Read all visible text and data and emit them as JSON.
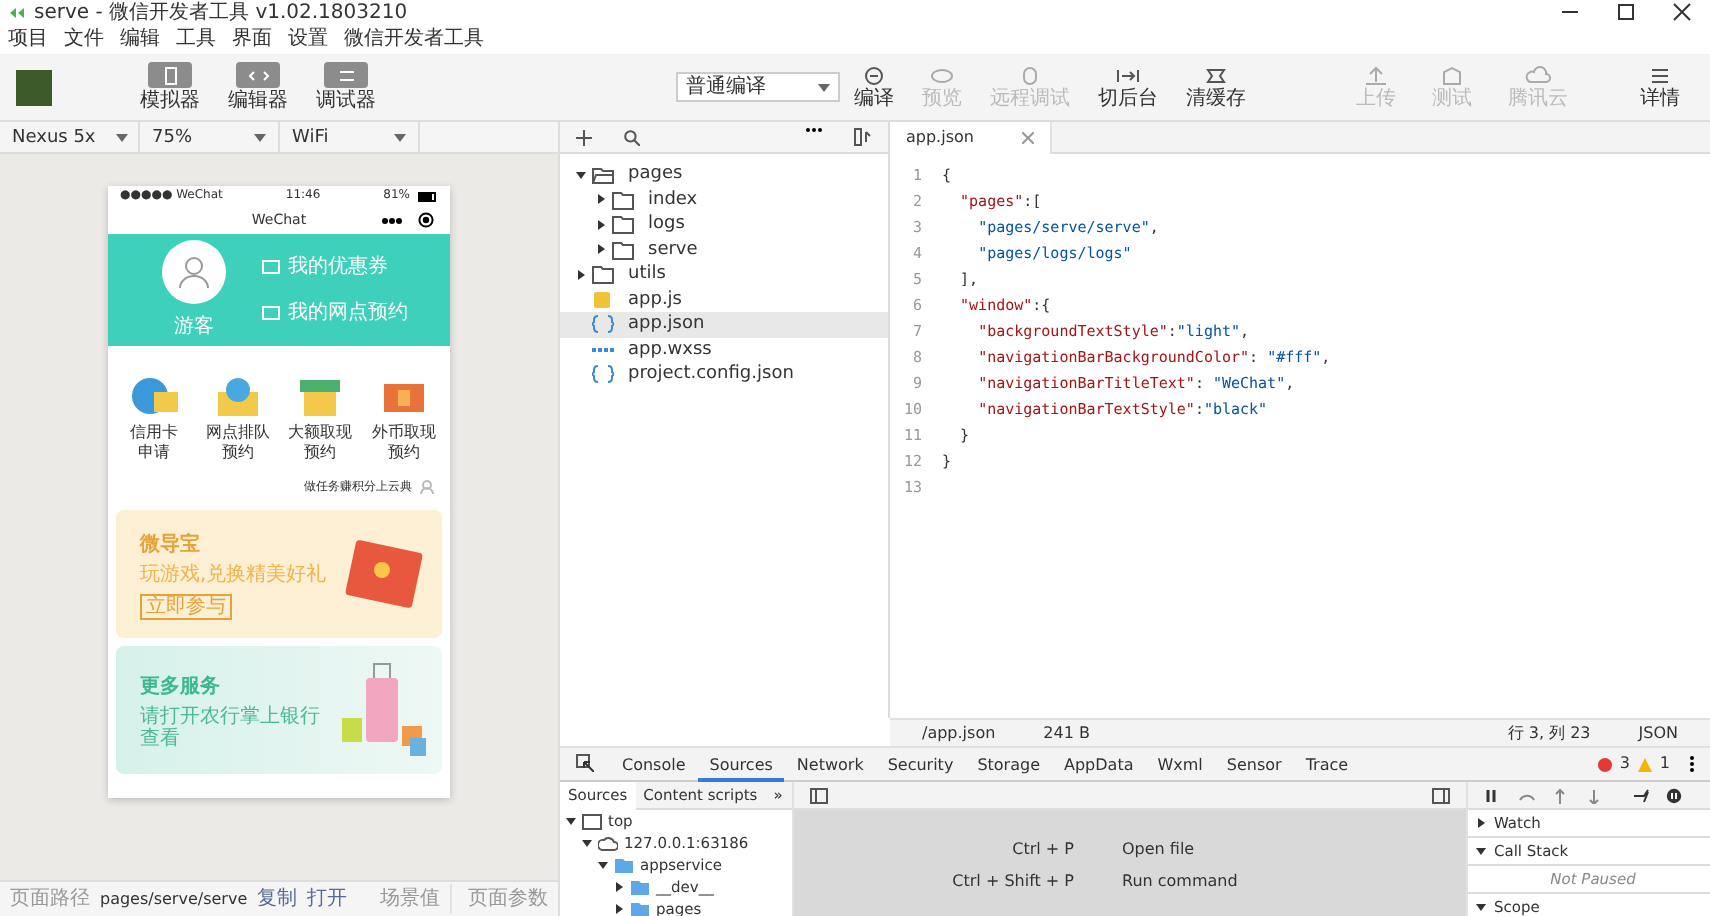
{
  "window": {
    "title": "serve - 微信开发者工具 v1.02.1803210"
  },
  "menu": [
    "项目",
    "文件",
    "编辑",
    "工具",
    "界面",
    "设置",
    "微信开发者工具"
  ],
  "toolbar": {
    "views": [
      {
        "label": "模拟器"
      },
      {
        "label": "编辑器"
      },
      {
        "label": "调试器"
      }
    ],
    "compile_mode": "普通编译",
    "actions": [
      {
        "label": "编译",
        "disabled": false
      },
      {
        "label": "预览",
        "disabled": true
      },
      {
        "label": "远程调试",
        "disabled": true
      },
      {
        "label": "切后台",
        "disabled": false
      },
      {
        "label": "清缓存",
        "disabled": false
      }
    ],
    "right_actions": [
      {
        "label": "上传",
        "disabled": true
      },
      {
        "label": "测试",
        "disabled": true
      },
      {
        "label": "腾讯云",
        "disabled": true
      },
      {
        "label": "详情",
        "disabled": false
      }
    ]
  },
  "simulator": {
    "device": "Nexus 5x",
    "zoom": "75%",
    "network": "WiFi",
    "phone": {
      "carrier": "●●●●● WeChat",
      "time": "11:46",
      "battery": "81%",
      "nav_title": "WeChat",
      "profile": {
        "name": "游客",
        "links": [
          "我的优惠券",
          "我的网点预约"
        ]
      },
      "services": [
        {
          "lines": [
            "信用卡",
            "申请"
          ]
        },
        {
          "lines": [
            "网点排队",
            "预约"
          ]
        },
        {
          "lines": [
            "大额取现",
            "预约"
          ]
        },
        {
          "lines": [
            "外币取现",
            "预约"
          ]
        }
      ],
      "note": "做任务赚积分上云典",
      "banners": [
        {
          "kind": "promo",
          "title": "微导宝",
          "subtitle": "玩游戏,兑换精美好礼",
          "button": "立即参与"
        },
        {
          "kind": "services",
          "title": "更多服务",
          "subtitle": "请打开农行掌上银行查看"
        }
      ]
    },
    "status_bar": {
      "path_label": "页面路径",
      "path": "pages/serve/serve",
      "copy": "复制",
      "open": "打开",
      "scene": "场景值",
      "params": "页面参数"
    }
  },
  "file_tree": [
    {
      "name": "pages",
      "kind": "folder",
      "expanded": true,
      "selected": false,
      "children": [
        {
          "name": "index",
          "kind": "folder",
          "expanded": false,
          "selected": false
        },
        {
          "name": "logs",
          "kind": "folder",
          "expanded": false,
          "selected": false
        },
        {
          "name": "serve",
          "kind": "folder",
          "expanded": false,
          "selected": false
        }
      ]
    },
    {
      "name": "utils",
      "kind": "folder",
      "expanded": false,
      "selected": false
    },
    {
      "name": "app.js",
      "kind": "js",
      "selected": false
    },
    {
      "name": "app.json",
      "kind": "json",
      "selected": true
    },
    {
      "name": "app.wxss",
      "kind": "wxss",
      "selected": false
    },
    {
      "name": "project.config.json",
      "kind": "json",
      "selected": false
    }
  ],
  "editor": {
    "tab": "app.json",
    "lines": [
      {
        "number": "1",
        "code": "{"
      },
      {
        "number": "2",
        "code": "  \"pages\":["
      },
      {
        "number": "3",
        "code": "    \"pages/serve/serve\","
      },
      {
        "number": "4",
        "code": "    \"pages/logs/logs\""
      },
      {
        "number": "5",
        "code": "  ],"
      },
      {
        "number": "6",
        "code": "  \"window\":{"
      },
      {
        "number": "7",
        "code": "    \"backgroundTextStyle\":\"light\","
      },
      {
        "number": "8",
        "code": "    \"navigationBarBackgroundColor\": \"#fff\","
      },
      {
        "number": "9",
        "code": "    \"navigationBarTitleText\": \"WeChat\","
      },
      {
        "number": "10",
        "code": "    \"navigationBarTextStyle\":\"black\""
      },
      {
        "number": "11",
        "code": "  }"
      },
      {
        "number": "12",
        "code": "}"
      },
      {
        "number": "13"
      }
    ],
    "status": {
      "path": "/app.json",
      "size": "241 B",
      "position": "行 3, 列 23",
      "language": "JSON"
    }
  },
  "devtools": {
    "tabs": [
      {
        "label": "Console",
        "selected": false
      },
      {
        "label": "Sources",
        "selected": true
      },
      {
        "label": "Network",
        "selected": false
      },
      {
        "label": "Security",
        "selected": false
      },
      {
        "label": "Storage",
        "selected": false
      },
      {
        "label": "AppData",
        "selected": false
      },
      {
        "label": "Wxml",
        "selected": false
      },
      {
        "label": "Sensor",
        "selected": false
      },
      {
        "label": "Trace",
        "selected": false
      }
    ],
    "errors": "3",
    "warnings": "1",
    "navigator_tabs": [
      {
        "label": "Sources",
        "selected": true
      },
      {
        "label": "Content scripts",
        "selected": false
      }
    ],
    "navigator_more": "»",
    "source_tree": [
      {
        "name": "top",
        "kind": "frame",
        "expanded": true,
        "children": [
          {
            "name": "127.0.0.1:63186",
            "kind": "origin",
            "expanded": true,
            "children": [
              {
                "name": "appservice",
                "kind": "folder",
                "expanded": true,
                "children": [
                  {
                    "name": "__dev__",
                    "kind": "folder",
                    "expanded": false
                  },
                  {
                    "name": "pages",
                    "kind": "folder",
                    "expanded": false
                  }
                ]
              }
            ]
          }
        ]
      }
    ],
    "shortcuts": [
      {
        "keys": "Ctrl + P",
        "action": "Open file"
      },
      {
        "keys": "Ctrl + Shift + P",
        "action": "Run command"
      }
    ],
    "debugger": [
      {
        "name": "Watch",
        "expanded": false
      },
      {
        "name": "Call Stack",
        "expanded": true,
        "message": "Not Paused"
      },
      {
        "name": "Scope",
        "expanded": true
      }
    ]
  }
}
